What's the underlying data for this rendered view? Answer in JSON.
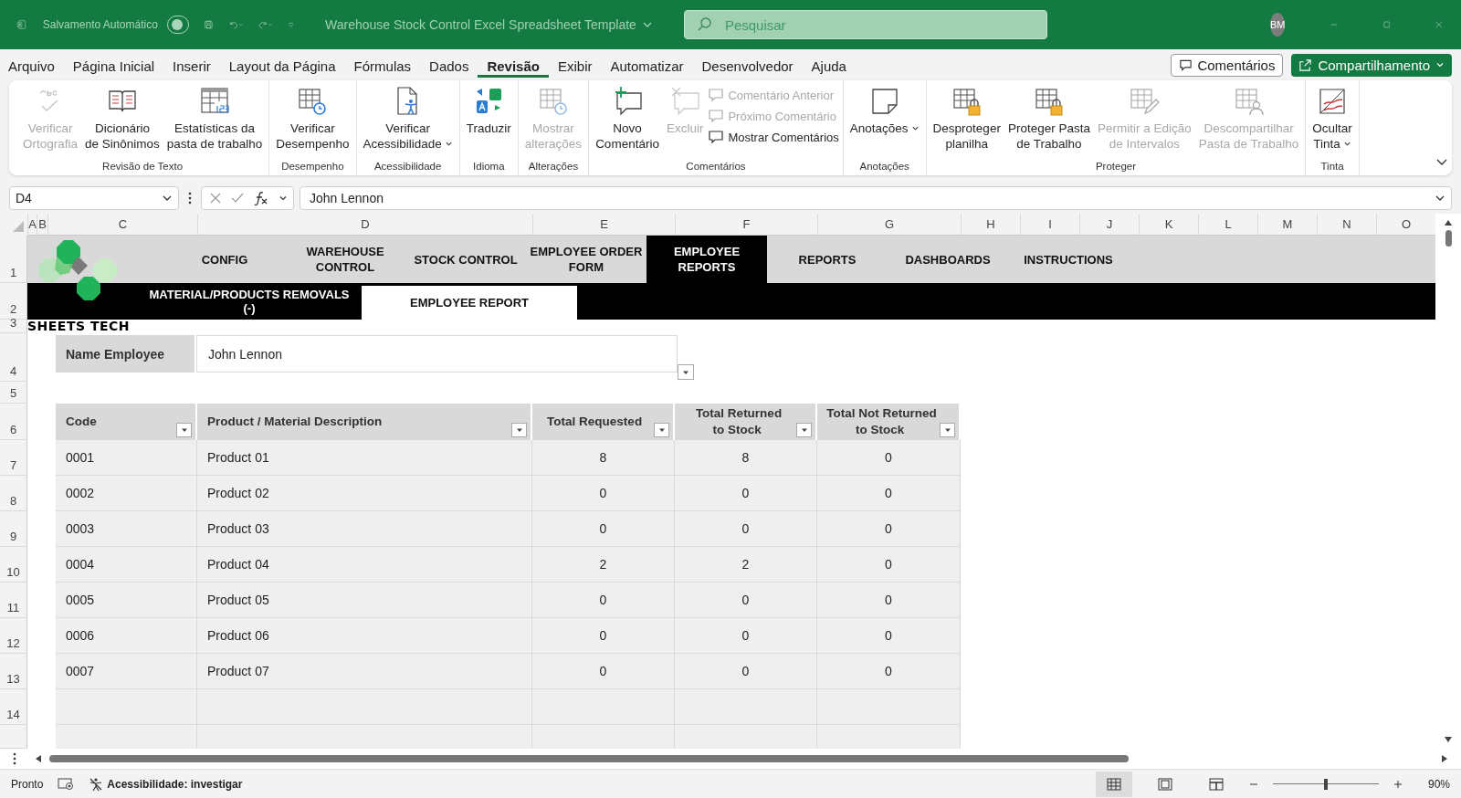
{
  "title_bar": {
    "autosave_label": "Salvamento Automático",
    "autosave_on": false,
    "document_title": "Warehouse Stock Control Excel Spreadsheet Template",
    "search": {
      "placeholder": "Pesquisar"
    },
    "avatar": "BM"
  },
  "menu": {
    "tabs": [
      {
        "label": "Arquivo",
        "selected": false
      },
      {
        "label": "Página Inicial",
        "selected": false
      },
      {
        "label": "Inserir",
        "selected": false
      },
      {
        "label": "Layout da Página",
        "selected": false
      },
      {
        "label": "Fórmulas",
        "selected": false
      },
      {
        "label": "Dados",
        "selected": false
      },
      {
        "label": "Revisão",
        "selected": true
      },
      {
        "label": "Exibir",
        "selected": false
      },
      {
        "label": "Automatizar",
        "selected": false
      },
      {
        "label": "Desenvolvedor",
        "selected": false
      },
      {
        "label": "Ajuda",
        "selected": false
      }
    ],
    "comments_button": "Comentários",
    "share_button": "Compartilhamento"
  },
  "ribbon": {
    "groups": [
      {
        "label": "Revisão de Texto",
        "items": [
          {
            "kind": "large",
            "label": "Verificar\nOrtografia",
            "disabled": true,
            "dropdown": false
          },
          {
            "kind": "large",
            "label": "Dicionário\nde Sinônimos",
            "disabled": false,
            "dropdown": false
          },
          {
            "kind": "large",
            "label": "Estatísticas da\npasta de trabalho",
            "disabled": false,
            "dropdown": false
          }
        ]
      },
      {
        "label": "Desempenho",
        "items": [
          {
            "kind": "large",
            "label": "Verificar\nDesempenho",
            "disabled": false,
            "dropdown": false
          }
        ]
      },
      {
        "label": "Acessibilidade",
        "items": [
          {
            "kind": "large",
            "label": "Verificar\nAcessibilidade",
            "disabled": false,
            "dropdown": true
          }
        ]
      },
      {
        "label": "Idioma",
        "items": [
          {
            "kind": "large",
            "label": "Traduzir",
            "disabled": false,
            "dropdown": false
          }
        ]
      },
      {
        "label": "Alterações",
        "items": [
          {
            "kind": "large",
            "label": "Mostrar\nalterações",
            "disabled": true,
            "dropdown": false
          }
        ]
      },
      {
        "label": "Comentários",
        "items": [
          {
            "kind": "large",
            "label": "Novo\nComentário",
            "disabled": false,
            "dropdown": false
          },
          {
            "kind": "large",
            "label": "Excluir",
            "disabled": true,
            "dropdown": false
          },
          {
            "kind": "stack",
            "items": [
              {
                "label": "Comentário Anterior",
                "disabled": true
              },
              {
                "label": "Próximo Comentário",
                "disabled": true
              },
              {
                "label": "Mostrar Comentários",
                "disabled": false
              }
            ]
          }
        ]
      },
      {
        "label": "Anotações",
        "items": [
          {
            "kind": "large",
            "label": "Anotações",
            "disabled": false,
            "dropdown": true
          }
        ]
      },
      {
        "label": "Proteger",
        "items": [
          {
            "kind": "large",
            "label": "Desproteger\nplanilha",
            "disabled": false,
            "dropdown": false
          },
          {
            "kind": "large",
            "label": "Proteger Pasta\nde Trabalho",
            "disabled": false,
            "dropdown": false
          },
          {
            "kind": "large",
            "label": "Permitir a Edição\nde Intervalos",
            "disabled": true,
            "dropdown": false
          },
          {
            "kind": "large",
            "label": "Descompartilhar\nPasta de Trabalho",
            "disabled": true,
            "dropdown": false
          }
        ]
      },
      {
        "label": "Tinta",
        "items": [
          {
            "kind": "large",
            "label": "Ocultar\nTinta",
            "disabled": false,
            "dropdown": true
          }
        ]
      }
    ]
  },
  "formula_bar": {
    "name_box": "D4",
    "formula": "John Lennon"
  },
  "columns": [
    "A",
    "B",
    "C",
    "D",
    "E",
    "F",
    "G",
    "H",
    "I",
    "J",
    "K",
    "L",
    "M",
    "N",
    "O"
  ],
  "rows": [
    "1",
    "2",
    "3",
    "4",
    "5",
    "6",
    "7",
    "8",
    "9",
    "10",
    "11",
    "12",
    "13",
    "14"
  ],
  "sheet": {
    "logo_text": "SHEETS TECH",
    "nav": [
      {
        "label": "CONFIG",
        "selected": false
      },
      {
        "label": "WAREHOUSE\nCONTROL",
        "selected": false
      },
      {
        "label": "STOCK CONTROL",
        "selected": false
      },
      {
        "label": "EMPLOYEE ORDER\nFORM",
        "selected": false
      },
      {
        "label": "EMPLOYEE\nREPORTS",
        "selected": true
      },
      {
        "label": "REPORTS",
        "selected": false
      },
      {
        "label": "DASHBOARDS",
        "selected": false
      },
      {
        "label": "INSTRUCTIONS",
        "selected": false
      }
    ],
    "subnav": [
      {
        "label": "MATERIAL/PRODUCTS REMOVALS\n(-)",
        "selected": false
      },
      {
        "label": "EMPLOYEE REPORT",
        "selected": true
      }
    ],
    "employee": {
      "label": "Name Employee",
      "value": "John Lennon"
    },
    "table": {
      "columns": [
        {
          "label": "Code",
          "kind": "text"
        },
        {
          "label": "Product / Material Description",
          "kind": "text"
        },
        {
          "label": "Total Requested",
          "kind": "number"
        },
        {
          "label": "Total Returned\nto Stock",
          "kind": "number"
        },
        {
          "label": "Total Not Returned\nto Stock",
          "kind": "number"
        }
      ],
      "rows": [
        [
          "0001",
          "Product 01",
          "8",
          "8",
          "0"
        ],
        [
          "0002",
          "Product 02",
          "0",
          "0",
          "0"
        ],
        [
          "0003",
          "Product 03",
          "0",
          "0",
          "0"
        ],
        [
          "0004",
          "Product 04",
          "2",
          "2",
          "0"
        ],
        [
          "0005",
          "Product 05",
          "0",
          "0",
          "0"
        ],
        [
          "0006",
          "Product 06",
          "0",
          "0",
          "0"
        ],
        [
          "0007",
          "Product 07",
          "0",
          "0",
          "0"
        ]
      ]
    }
  },
  "status_bar": {
    "status": "Pronto",
    "accessibility": "Acessibilidade: investigar",
    "views": [
      {
        "selected": true
      },
      {
        "selected": false
      },
      {
        "selected": false
      }
    ],
    "zoom": {
      "level": 0.5,
      "reading": "90%"
    }
  }
}
